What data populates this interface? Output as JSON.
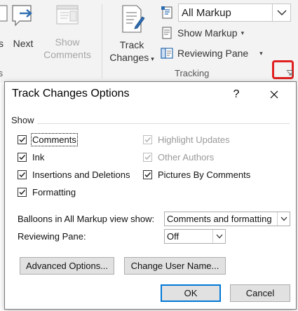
{
  "ribbon": {
    "partial_left_label": "s",
    "next_label": "Next",
    "show_comments_line1": "Show",
    "show_comments_line2": "Comments",
    "left_group_partial_label": "ts",
    "track_changes_line1": "Track",
    "track_changes_line2": "Changes",
    "markup_value": "All Markup",
    "show_markup_label": "Show Markup",
    "reviewing_pane_label": "Reviewing Pane",
    "tracking_group_label": "Tracking"
  },
  "dialog": {
    "title": "Track Changes Options",
    "help_label": "?",
    "show_section_label": "Show",
    "checkboxes_left": [
      {
        "label": "Comments",
        "checked": true,
        "disabled": false
      },
      {
        "label": "Ink",
        "checked": true,
        "disabled": false
      },
      {
        "label": "Insertions and Deletions",
        "checked": true,
        "disabled": false
      },
      {
        "label": "Formatting",
        "checked": true,
        "disabled": false
      }
    ],
    "checkboxes_right": [
      {
        "label": "Highlight Updates",
        "checked": true,
        "disabled": true
      },
      {
        "label": "Other Authors",
        "checked": true,
        "disabled": true
      },
      {
        "label": "Pictures By Comments",
        "checked": true,
        "disabled": false
      }
    ],
    "balloons_label": "Balloons in All Markup view show:",
    "balloons_value": "Comments and formatting",
    "reviewing_pane_label": "Reviewing Pane:",
    "reviewing_pane_value": "Off",
    "advanced_options_label": "Advanced Options...",
    "change_user_name_label": "Change User Name...",
    "ok_label": "OK",
    "cancel_label": "Cancel"
  },
  "colors": {
    "ribbon_bg": "#f3f3f3",
    "highlight_border": "#e02020",
    "default_button_border": "#0078d7",
    "icon_blue": "#2b6cb0"
  }
}
